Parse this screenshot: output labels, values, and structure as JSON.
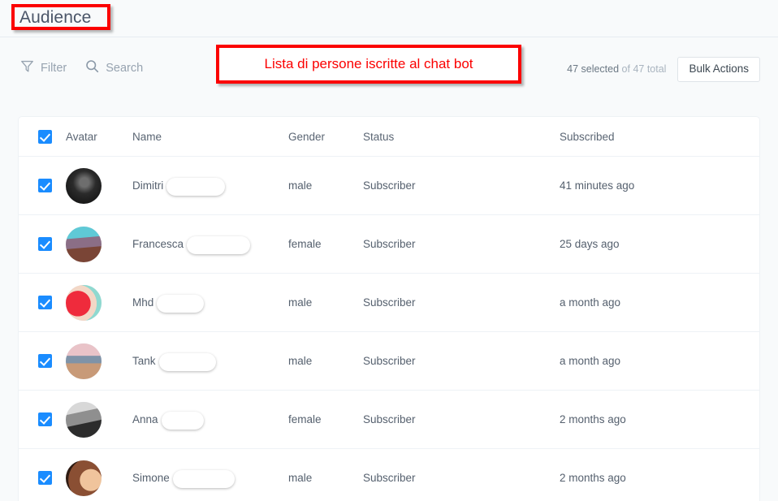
{
  "header": {
    "title": "Audience"
  },
  "toolbar": {
    "filter_label": "Filter",
    "filter_icon": "funnel-icon",
    "search_label": "Search",
    "search_icon": "magnifier-icon",
    "selection_count": "47 selected",
    "selection_total": "of 47 total",
    "bulk_actions_label": "Bulk Actions"
  },
  "annotations": [
    {
      "name": "title-highlight",
      "text": ""
    },
    {
      "name": "note",
      "text": "Lista di persone iscritte al chat bot"
    }
  ],
  "table": {
    "select_all_checked": true,
    "columns": [
      "Avatar",
      "Name",
      "Gender",
      "Status",
      "Subscribed"
    ],
    "rows": [
      {
        "checked": true,
        "name": "Dimitri",
        "name_redacted": true,
        "gender": "male",
        "status": "Subscriber",
        "subscribed": "41 minutes ago"
      },
      {
        "checked": true,
        "name": "Francesca",
        "name_redacted": true,
        "gender": "female",
        "status": "Subscriber",
        "subscribed": "25 days ago"
      },
      {
        "checked": true,
        "name": "Mhd",
        "name_redacted": true,
        "gender": "male",
        "status": "Subscriber",
        "subscribed": "a month ago"
      },
      {
        "checked": true,
        "name": "Tank",
        "name_redacted": true,
        "gender": "male",
        "status": "Subscriber",
        "subscribed": "a month ago"
      },
      {
        "checked": true,
        "name": "Anna",
        "name_redacted": true,
        "gender": "female",
        "status": "Subscriber",
        "subscribed": "2 months ago"
      },
      {
        "checked": true,
        "name": "Simone",
        "name_redacted": true,
        "gender": "male",
        "status": "Subscriber",
        "subscribed": "2 months ago"
      }
    ]
  },
  "colors": {
    "accent": "#1a8cff",
    "annotation": "#fb0000",
    "page_bg": "#f8fafb",
    "card_bg": "#ffffff",
    "text": "#55606e",
    "muted": "#97a3b0"
  }
}
